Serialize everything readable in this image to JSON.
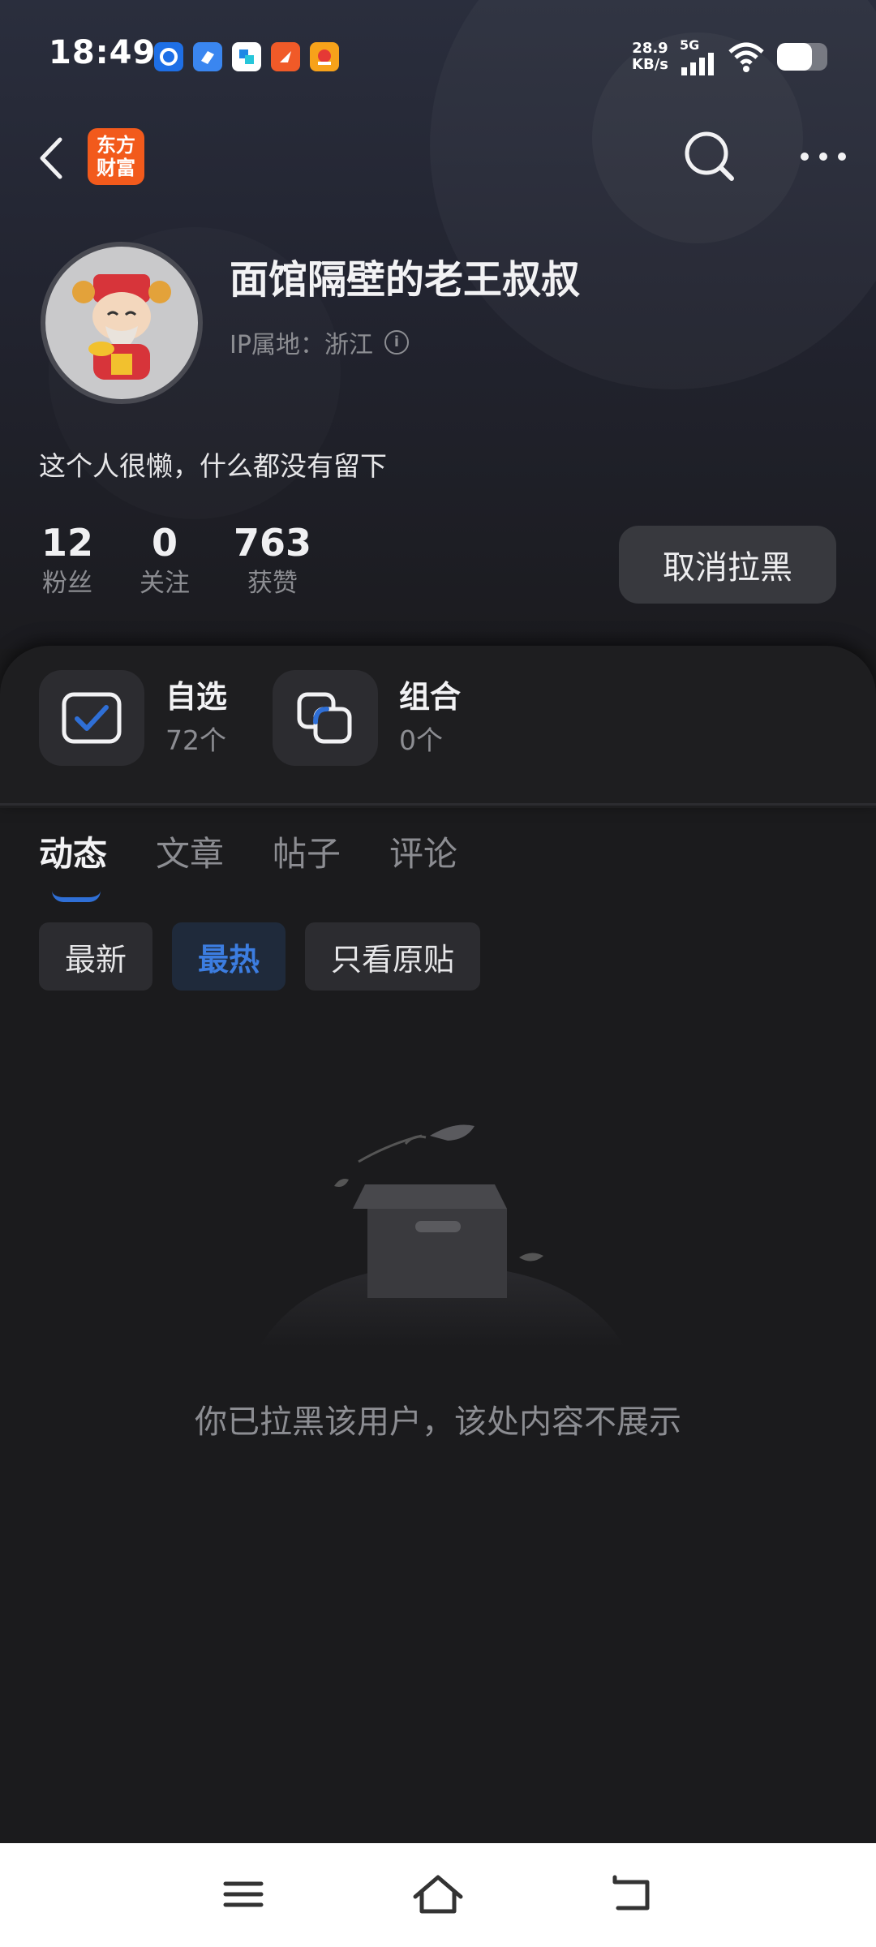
{
  "status_bar": {
    "time": "18:49",
    "net_speed_value": "28.9",
    "net_speed_unit": "KB/s",
    "network": "5G",
    "battery_level": 0.7
  },
  "nav": {
    "logo_line1": "东方",
    "logo_line2": "财富"
  },
  "profile": {
    "username": "面馆隔壁的老王叔叔",
    "ip_location": "IP属地：浙江",
    "bio": "这个人很懒，什么都没有留下",
    "stats": [
      {
        "value": "12",
        "label": "粉丝"
      },
      {
        "value": "0",
        "label": "关注"
      },
      {
        "value": "763",
        "label": "获赞"
      }
    ],
    "unblock_label": "取消拉黑"
  },
  "shortcuts": [
    {
      "title": "自选",
      "count": "72个",
      "icon": "checkbox-icon"
    },
    {
      "title": "组合",
      "count": "0个",
      "icon": "portfolio-icon"
    }
  ],
  "tabs": [
    {
      "label": "动态",
      "active": true
    },
    {
      "label": "文章",
      "active": false
    },
    {
      "label": "帖子",
      "active": false
    },
    {
      "label": "评论",
      "active": false
    }
  ],
  "filters": [
    {
      "label": "最新",
      "active": false
    },
    {
      "label": "最热",
      "active": true
    },
    {
      "label": "只看原贴",
      "active": false
    }
  ],
  "empty_state": {
    "message": "你已拉黑该用户，该处内容不展示"
  },
  "colors": {
    "accent": "#3c7de0",
    "logo": "#f25a1c",
    "background": "#1b1b1d"
  }
}
